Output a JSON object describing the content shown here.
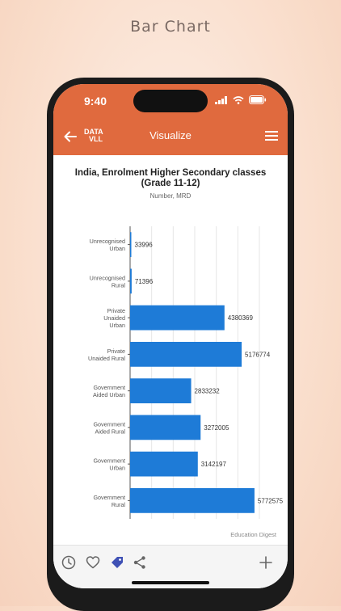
{
  "promo": {
    "title": "Bar Chart"
  },
  "status": {
    "time": "9:40"
  },
  "nav": {
    "logo_top": "DATA",
    "logo_bottom": "VLL",
    "title": "Visualize"
  },
  "chart_data": {
    "type": "bar",
    "orientation": "horizontal",
    "title": "India, Enrolment Higher Secondary classes (Grade 11-12)",
    "subtitle": "Number, MRD",
    "source": "Education Digest",
    "categories": [
      [
        "Unrecognised",
        "Urban"
      ],
      [
        "Unrecognised",
        "Rural"
      ],
      [
        "Private",
        "Unaided",
        "Urban"
      ],
      [
        "Private",
        "Unaided Rural"
      ],
      [
        "Government",
        "Aided Urban"
      ],
      [
        "Government",
        "Aided Rural"
      ],
      [
        "Government",
        "Urban"
      ],
      [
        "Government",
        "Rural"
      ]
    ],
    "values": [
      33996,
      71396,
      4380369,
      5176774,
      2833232,
      3272005,
      3142197,
      5772575
    ],
    "labels": [
      "33996",
      "71396",
      "4380369",
      "5176774",
      "2833232",
      "3272005",
      "3142197",
      "5772575"
    ],
    "xlim": [
      0,
      6000000
    ],
    "grid": true,
    "bar_color": "#1e7bd7"
  },
  "colors": {
    "accent": "#e06a3e",
    "bar": "#1e7bd7"
  }
}
